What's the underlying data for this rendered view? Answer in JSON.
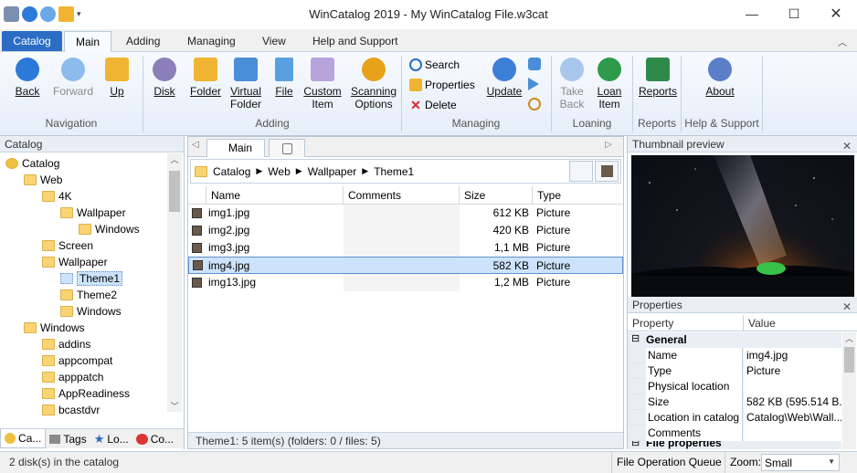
{
  "window": {
    "title": "WinCatalog 2019 - My WinCatalog File.w3cat"
  },
  "ribbon_tabs": [
    {
      "label": "Catalog"
    },
    {
      "label": "Main"
    },
    {
      "label": "Adding"
    },
    {
      "label": "Managing"
    },
    {
      "label": "View"
    },
    {
      "label": "Help and Support"
    }
  ],
  "ribbon": {
    "back": "Back",
    "forward": "Forward",
    "up": "Up",
    "disk": "Disk",
    "folder": "Folder",
    "virtual_folder_1": "Virtual",
    "virtual_folder_2": "Folder",
    "file": "File",
    "custom_item_1": "Custom",
    "custom_item_2": "Item",
    "scanning_1": "Scanning",
    "scanning_2": "Options",
    "search": "Search",
    "properties": "Properties",
    "delete": "Delete",
    "update": "Update",
    "take_back_1": "Take",
    "take_back_2": "Back",
    "loan_item_1": "Loan",
    "loan_item_2": "Item",
    "reports": "Reports",
    "about": "About",
    "groups": {
      "navigation": "Navigation",
      "adding": "Adding",
      "managing": "Managing",
      "loaning": "Loaning",
      "reports": "Reports",
      "help": "Help & Support"
    }
  },
  "catalog_panel": {
    "title": "Catalog",
    "tree": [
      {
        "label": "Catalog"
      },
      {
        "label": "Web"
      },
      {
        "label": "4K"
      },
      {
        "label": "Wallpaper"
      },
      {
        "label": "Windows"
      },
      {
        "label": "Screen"
      },
      {
        "label": "Wallpaper"
      },
      {
        "label": "Theme1"
      },
      {
        "label": "Theme2"
      },
      {
        "label": "Windows"
      },
      {
        "label": "Windows"
      },
      {
        "label": "addins"
      },
      {
        "label": "appcompat"
      },
      {
        "label": "apppatch"
      },
      {
        "label": "AppReadiness"
      },
      {
        "label": "bcastdvr"
      }
    ],
    "tabs": [
      {
        "label": "Ca..."
      },
      {
        "label": "Tags"
      },
      {
        "label": "Lo..."
      },
      {
        "label": "Co..."
      }
    ]
  },
  "center": {
    "doc_tab": "Main",
    "breadcrumb": [
      "Catalog",
      "Web",
      "Wallpaper",
      "Theme1"
    ],
    "columns": {
      "name": "Name",
      "comments": "Comments",
      "size": "Size",
      "type": "Type"
    },
    "files": [
      {
        "name": "img1.jpg",
        "comments": "",
        "size": "612 KB",
        "type": "Picture"
      },
      {
        "name": "img2.jpg",
        "comments": "",
        "size": "420 KB",
        "type": "Picture"
      },
      {
        "name": "img3.jpg",
        "comments": "",
        "size": "1,1 MB",
        "type": "Picture"
      },
      {
        "name": "img4.jpg",
        "comments": "",
        "size": "582 KB",
        "type": "Picture"
      },
      {
        "name": "img13.jpg",
        "comments": "",
        "size": "1,2 MB",
        "type": "Picture"
      }
    ],
    "status": "Theme1: 5 item(s) (folders: 0 / files: 5)"
  },
  "thumbnail_panel": {
    "title": "Thumbnail preview"
  },
  "properties_panel": {
    "title": "Properties",
    "col_property": "Property",
    "col_value": "Value",
    "section_general": "General",
    "rows": [
      {
        "key": "Name",
        "value": "img4.jpg"
      },
      {
        "key": "Type",
        "value": "Picture"
      },
      {
        "key": "Physical location",
        "value": ""
      },
      {
        "key": "Size",
        "value": "582 KB (595.514 B..."
      },
      {
        "key": "Location in catalog",
        "value": "Catalog\\Web\\Wall..."
      },
      {
        "key": "Comments",
        "value": ""
      }
    ],
    "section_file": "File properties"
  },
  "statusbar": {
    "disks": "2 disk(s) in the catalog",
    "queue": "File Operation Queue",
    "zoom_label": "Zoom:",
    "zoom_value": "Small"
  },
  "colors": {
    "accent": "#2b6cc4",
    "selection": "#cde3fb",
    "folder": "#f9d472"
  }
}
